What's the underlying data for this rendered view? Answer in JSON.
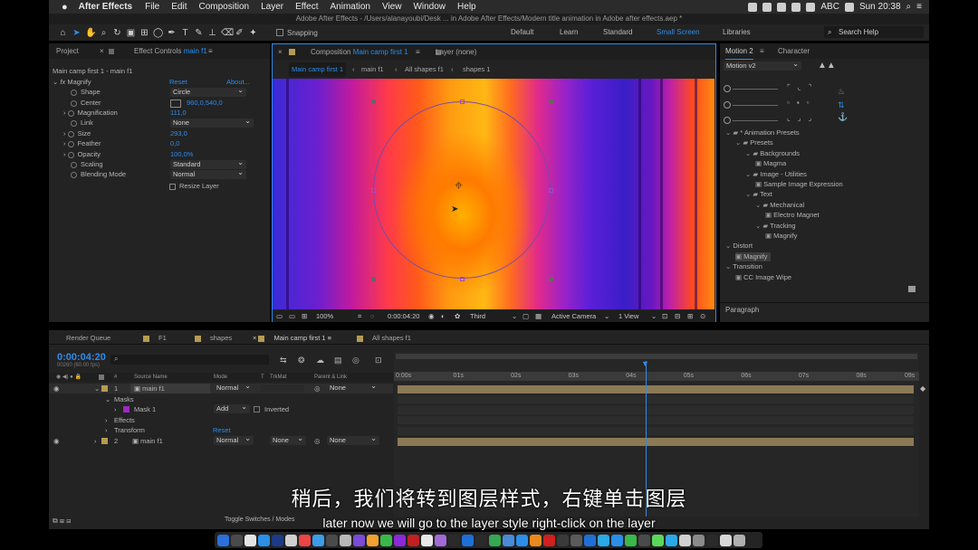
{
  "menubar": {
    "apple": "",
    "app": "After Effects",
    "items": [
      "File",
      "Edit",
      "Composition",
      "Layer",
      "Effect",
      "Animation",
      "View",
      "Window",
      "Help"
    ],
    "input_source": "ABC",
    "clock": "Sun 20:38"
  },
  "window_title": "Adobe After Effects - /Users/alanayoubi/Desk ... in Adobe After Effects/Modern title animation in Adobe after effects.aep *",
  "toolbar": {
    "snapping": "Snapping",
    "workspaces": [
      "Default",
      "Learn",
      "Standard",
      "Small Screen",
      "Libraries"
    ],
    "active_workspace": "Small Screen",
    "search_placeholder": "Search Help"
  },
  "left_panel": {
    "tabs": [
      "Project",
      "Effect Controls main f1"
    ],
    "effect_controls_label": "Effect Controls",
    "effect_controls_layer": "main f1",
    "header": "Main camp first 1 - main f1",
    "effect": {
      "name": "Magnify",
      "reset": "Reset",
      "about": "About..."
    },
    "properties": [
      {
        "label": "Shape",
        "value": "Circle",
        "kind": "dropdown"
      },
      {
        "label": "Center",
        "value": "960,0,540,0",
        "kind": "point"
      },
      {
        "label": "Magnification",
        "value": "111,0",
        "kind": "value"
      },
      {
        "label": "Link",
        "value": "None",
        "kind": "dropdown"
      },
      {
        "label": "Size",
        "value": "293,0",
        "kind": "value"
      },
      {
        "label": "Feather",
        "value": "0,0",
        "kind": "value"
      },
      {
        "label": "Opacity",
        "value": "100,0%",
        "kind": "value"
      },
      {
        "label": "Scaling",
        "value": "Standard",
        "kind": "dropdown"
      },
      {
        "label": "Blending Mode",
        "value": "Normal",
        "kind": "dropdown"
      }
    ],
    "resize_layer": "Resize Layer"
  },
  "comp_panel": {
    "tab_prefix": "Composition",
    "tab_name": "Main camp first 1",
    "layer_tab": "Layer (none)",
    "breadcrumbs": [
      "Main camp first 1",
      "main f1",
      "All shapes f1",
      "shapes 1"
    ],
    "footer": {
      "zoom": "100%",
      "time": "0:00:04:20",
      "resolution": "Third",
      "camera": "Active Camera",
      "views": "1 View"
    }
  },
  "right_panel": {
    "tabs": [
      "Motion 2",
      "Character"
    ],
    "preset": "Motion v2",
    "paragraph": "Paragraph",
    "tree": [
      {
        "label": "* Animation Presets",
        "indent": 0,
        "kind": "folder"
      },
      {
        "label": "Presets",
        "indent": 1,
        "kind": "folder"
      },
      {
        "label": "Backgrounds",
        "indent": 2,
        "kind": "folder"
      },
      {
        "label": "Magma",
        "indent": 3,
        "kind": "file"
      },
      {
        "label": "Image - Utilities",
        "indent": 2,
        "kind": "folder"
      },
      {
        "label": "Sample Image Expression",
        "indent": 3,
        "kind": "file"
      },
      {
        "label": "Text",
        "indent": 2,
        "kind": "folder"
      },
      {
        "label": "Mechanical",
        "indent": 3,
        "kind": "folder"
      },
      {
        "label": "Electro Magnet",
        "indent": 4,
        "kind": "file"
      },
      {
        "label": "Tracking",
        "indent": 3,
        "kind": "folder"
      },
      {
        "label": "Magnify",
        "indent": 4,
        "kind": "file"
      },
      {
        "label": "Distort",
        "indent": 0,
        "kind": "category"
      },
      {
        "label": "Magnify",
        "indent": 1,
        "kind": "effect-selected"
      },
      {
        "label": "Transition",
        "indent": 0,
        "kind": "category"
      },
      {
        "label": "CC Image Wipe",
        "indent": 1,
        "kind": "effect"
      }
    ]
  },
  "timeline": {
    "tabs": [
      "Render Queue",
      "F1",
      "shapes",
      "Main camp first 1",
      "All shapes f1"
    ],
    "active_tab": "Main camp first 1",
    "timecode": "0:00:04:20",
    "frame_info": "00260 (60.00 fps)",
    "columns": [
      "Source Name",
      "Mode",
      "T",
      "TrkMat",
      "Parent & Link"
    ],
    "ruler": [
      "0:00s",
      "01s",
      "02s",
      "03s",
      "04s",
      "05s",
      "06s",
      "07s",
      "08s",
      "09s"
    ],
    "layers": [
      {
        "num": "1",
        "name": "main f1",
        "mode": "Normal",
        "trkmat": "",
        "parent": "None"
      },
      {
        "num": "2",
        "name": "main f1",
        "mode": "Normal",
        "trkmat": "None",
        "parent": "None"
      }
    ],
    "masks_label": "Masks",
    "mask_name": "Mask 1",
    "mask_mode": "Add",
    "mask_inverted": "Inverted",
    "effects_label": "Effects",
    "transform_label": "Transform",
    "transform_reset": "Reset",
    "toggle": "Toggle Switches / Modes"
  },
  "subtitles": {
    "zh": "稍后，我们将转到图层样式，右键单击图层",
    "en": "later now we will go to the layer style right-click on the layer"
  },
  "colors": {
    "accent": "#2d8ceb",
    "panel": "#232323",
    "layer_bar": "#8c7a55",
    "label": "#b59a52"
  }
}
